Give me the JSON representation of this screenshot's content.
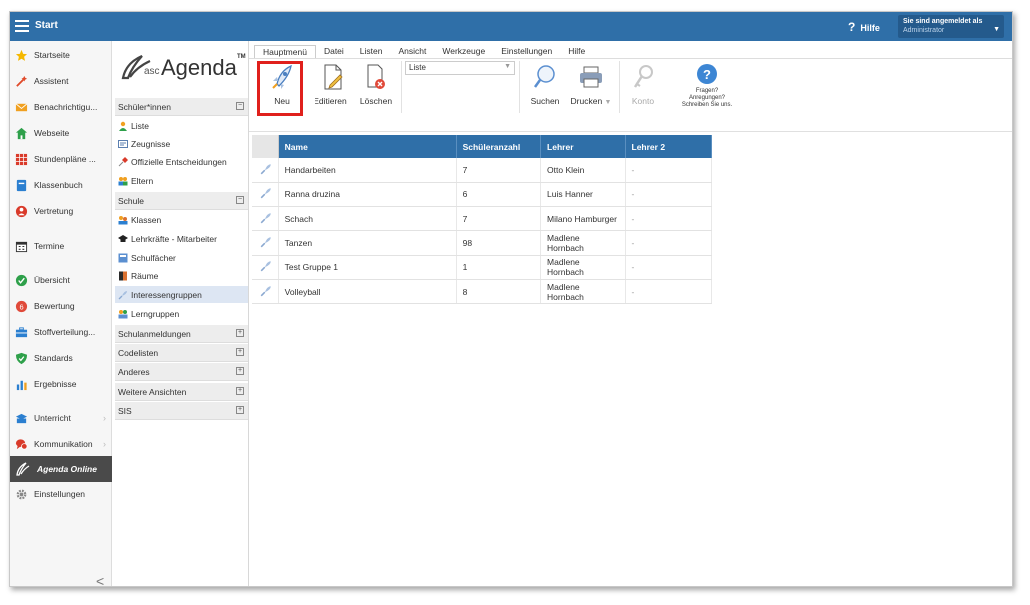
{
  "topbar": {
    "title": "Start",
    "help": "Hilfe",
    "login_line1": "Sie sind angemeldet als",
    "login_line2": "Administrator"
  },
  "leftnav": {
    "items": [
      {
        "label": "Startseite",
        "icon": "star-icon",
        "color": "#f5b800"
      },
      {
        "label": "Assistent",
        "icon": "wand-icon",
        "color": "#e04a2a"
      },
      {
        "label": "Benachrichtigu...",
        "icon": "envelope-icon",
        "color": "#f0a020"
      },
      {
        "label": "Webseite",
        "icon": "home-icon",
        "color": "#2ea04a"
      },
      {
        "label": "Stundenpläne ...",
        "icon": "timetable-icon",
        "color": "#d93a2a"
      },
      {
        "label": "Klassenbuch",
        "icon": "book-icon",
        "color": "#2b7fd0"
      },
      {
        "label": "Vertretung",
        "icon": "substitution-icon",
        "color": "#d93a2a"
      },
      {
        "label": "Termine",
        "icon": "calendar-icon",
        "color": "#333333"
      },
      {
        "label": "Übersicht",
        "icon": "check-circle-icon",
        "color": "#2ea04a"
      },
      {
        "label": "Bewertung",
        "icon": "rating-icon",
        "color": "#e04a3a"
      },
      {
        "label": "Stoffverteilung...",
        "icon": "briefcase-icon",
        "color": "#2b7fd0"
      },
      {
        "label": "Standards",
        "icon": "shield-icon",
        "color": "#2ea04a"
      },
      {
        "label": "Ergebnisse",
        "icon": "bar-chart-icon",
        "color": "#2b7fd0"
      },
      {
        "label": "Unterricht",
        "icon": "teaching-icon",
        "color": "#2b7fd0"
      },
      {
        "label": "Kommunikation",
        "icon": "chat-icon",
        "color": "#d93a2a"
      },
      {
        "label": "Agenda Online",
        "icon": "agenda-icon",
        "color": "#ffffff"
      },
      {
        "label": "Einstellungen",
        "icon": "gear-icon",
        "color": "#888888"
      }
    ],
    "collapse": "<"
  },
  "panel2": {
    "logo_text": "Agenda",
    "logo_prefix": "asc",
    "logo_tm": "TM",
    "sections": [
      {
        "label": "Schüler*innen",
        "toggle": "−"
      },
      {
        "label": "Schule",
        "toggle": "−"
      },
      {
        "label": "Schulanmeldungen",
        "toggle": "+"
      },
      {
        "label": "Codelisten",
        "toggle": "+"
      },
      {
        "label": "Anderes",
        "toggle": "+"
      },
      {
        "label": "Weitere Ansichten",
        "toggle": "+"
      },
      {
        "label": "SIS",
        "toggle": "+"
      }
    ],
    "sub1": [
      {
        "label": "Liste",
        "icon": "person-icon"
      },
      {
        "label": "Zeugnisse",
        "icon": "certificate-icon"
      },
      {
        "label": "Offizielle Entscheidungen",
        "icon": "pin-icon"
      },
      {
        "label": "Eltern",
        "icon": "parents-icon"
      }
    ],
    "sub2": [
      {
        "label": "Klassen",
        "icon": "class-icon"
      },
      {
        "label": "Lehrkräfte - Mitarbeiter",
        "icon": "graduation-cap-icon"
      },
      {
        "label": "Schulfächer",
        "icon": "subject-icon"
      },
      {
        "label": "Räume",
        "icon": "door-icon"
      },
      {
        "label": "Interessengruppen",
        "icon": "interest-group-icon"
      },
      {
        "label": "Lerngruppen",
        "icon": "learning-group-icon"
      }
    ]
  },
  "menutabs": [
    "Hauptmenü",
    "Datei",
    "Listen",
    "Ansicht",
    "Werkzeuge",
    "Einstellungen",
    "Hilfe"
  ],
  "ribbon": {
    "neu": "Neu",
    "editieren": "Editieren",
    "loeschen": "Löschen",
    "select_value": "Liste",
    "suchen": "Suchen",
    "drucken": "Drucken",
    "konto": "Konto",
    "fragen1": "Fragen?",
    "fragen2": "Anregungen?",
    "fragen3": "Schreiben Sie uns."
  },
  "grid": {
    "columns": [
      "Name",
      "Schüleranzahl",
      "Lehrer",
      "Lehrer 2"
    ],
    "rows": [
      [
        "Handarbeiten",
        "7",
        "Otto Klein",
        "-"
      ],
      [
        "Ranna druzina",
        "6",
        "Luis Hanner",
        "-"
      ],
      [
        "Schach",
        "7",
        "Milano Hamburger",
        "-"
      ],
      [
        "Tanzen",
        "98",
        "Madlene Hornbach",
        "-"
      ],
      [
        "Test Gruppe 1",
        "1",
        "Madlene Hornbach",
        "-"
      ],
      [
        "Volleyball",
        "8",
        "Madlene Hornbach",
        "-"
      ]
    ]
  }
}
